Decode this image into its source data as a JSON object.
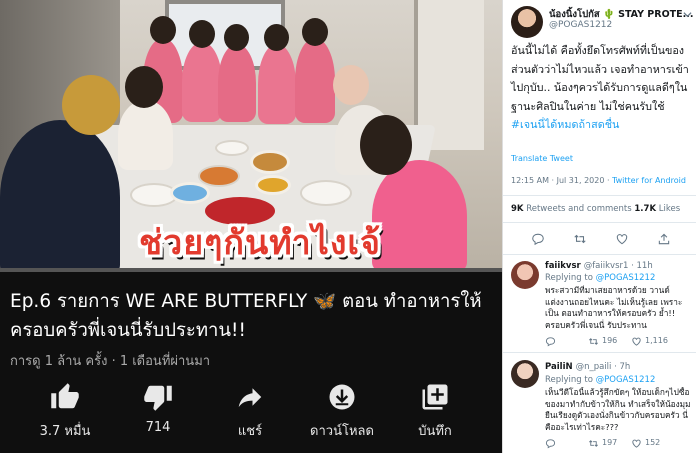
{
  "video": {
    "overlay_caption": "ช่วยๆกันทำไงเจ้",
    "title": "Ep.6 รายการ WE ARE BUTTERFLY 🦋 ตอน ทำอาหารให้ครอบครัวพี่เจนนี่รับประทาน!!",
    "meta": "การดู 1 ล้าน ครั้ง · 1 เดือนที่ผ่านมา",
    "progress": 0.0,
    "actions": [
      {
        "icon": "thumbs-up-icon",
        "label": "3.7 หมื่น"
      },
      {
        "icon": "thumbs-down-icon",
        "label": "714"
      },
      {
        "icon": "share-icon",
        "label": "แชร์"
      },
      {
        "icon": "download-icon",
        "label": "ดาวน์โหลด"
      },
      {
        "icon": "save-playlist-icon",
        "label": "บันทึก"
      }
    ],
    "colors": {
      "background": "#0f0f0f",
      "caption": "#e23a2e",
      "progress": "#ff0000"
    }
  },
  "tweet": {
    "name": "น้องนิ้งโปกัส 🌵 STAY PROTE...",
    "handle": "@POGAS1212",
    "body_text": "อันนี้ไม่ได้ คือทั้งยึดโทรศัพท์ที่เป็นของส่วนตัวว่าไม่ไหวแล้ว เจอทำอาหารเข้าไปกุบับ.. น้องๆควรได้รับการดูแลดีๆในฐานะศิลปินในค่าย ไม่ใช่คนรับใช้",
    "hashtag": "#เจนนี่ได้หมดถ้าสดชื่น",
    "translate": "Translate Tweet",
    "time": "12:15 AM · Jul 31, 2020 · ",
    "source": "Twitter for Android",
    "retweets_count": "9K",
    "retweets_label": " Retweets and comments  ",
    "likes_count": "1.7K",
    "likes_label": " Likes",
    "accent": "#1da1f2"
  },
  "replies": [
    {
      "name": "faiikvsr",
      "handle": "@faiikvsr1 · 11h",
      "replying_label": "Replying to ",
      "replying_to": "@POGAS1212",
      "text": "พระสวามีที่มาเสยอาหารด้วย วานด์แต่งงานถอยไหนคะ ไม่เห็นรู้เลย เพราะเป็น ตอนทำอาหารให้ครอบครัว ย้ำ!! ครอบครัวพี่เจนนี่ รับประทาน",
      "retweets": "196",
      "likes": "1,116"
    },
    {
      "name": "PailiN",
      "handle": "@n_paili · 7h",
      "replying_label": "Replying to ",
      "replying_to": "@POGAS1212",
      "text": "เห็นวีดีโอนี้แล้วรู้สึกขัดๆ ให้อบเด็กๆไปซื้อของมาทำกับข้าวให้กิน ทำเสร็จให้น้องมุมยืนเรียงดูตัวเองนั่งกินข้าวกับครอบครัว นี่คืออะไรเท่าไรคะ???",
      "retweets": "197",
      "likes": "152"
    }
  ]
}
